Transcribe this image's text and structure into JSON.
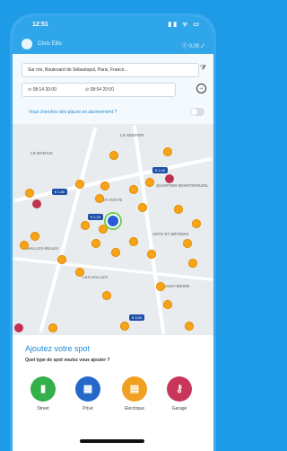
{
  "status": {
    "time": "12:51",
    "icons": "▮▮ ᯤ ▭"
  },
  "appbar": {
    "username": "Chris Ellis",
    "wallet": "ⓒ 0,00 ✓"
  },
  "search": {
    "address": "Sur rire, Boulevard de Sébastopol, Paris, France...",
    "date_from": "⊙ 08:14 30:00",
    "date_to": "⊙ 08:54 20:00",
    "go_icon": "→",
    "subscribe_text": "Vous cherchez des places en abonnement ?"
  },
  "map": {
    "labels": [
      "LE MARAIS",
      "HALLES-REAUX",
      "LES HALLES",
      "ARTS ET MÉTIERS",
      "QUARTIER MONTORGUEIL",
      "SAINT-MERRI",
      "LE SENTIER",
      "ST-AVOYE"
    ],
    "tags": [
      "€ 1,80",
      "€ 2,40",
      "€ 1,20",
      "€ 3,00"
    ]
  },
  "sheet": {
    "title": "Ajoutez votre spot",
    "subtitle": "Quel type de spot voulez vous ajouter ?",
    "options": [
      {
        "label": "Street",
        "color": "#33b04a",
        "icon": "▮"
      },
      {
        "label": "Privé",
        "color": "#2469c9",
        "icon": "▦"
      },
      {
        "label": "Electrique",
        "color": "#f0a020",
        "icon": "▤"
      },
      {
        "label": "Garage",
        "color": "#c8365a",
        "icon": "⚷"
      }
    ]
  }
}
